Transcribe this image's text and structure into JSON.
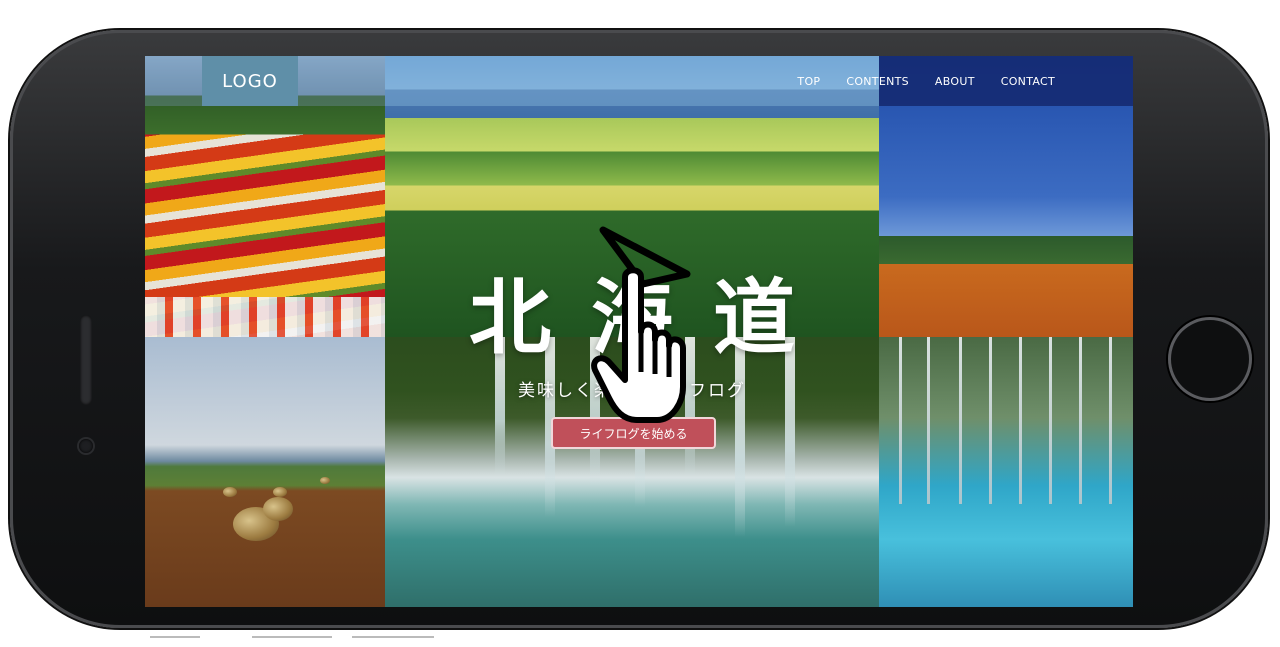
{
  "nav": {
    "logo": "LOGO",
    "links": [
      "TOP",
      "CONTENTS",
      "ABOUT",
      "CONTACT"
    ]
  },
  "hero": {
    "title": "北海道",
    "subtitle": "美味しく楽しくライフログ",
    "cta_label": "ライフログを始める"
  },
  "colors": {
    "cta": "#c0505a",
    "logo_bg": "#5f8fa8",
    "nav_right": "#14286e"
  },
  "icons": {
    "cursor": "hand-pointer-cursor-icon"
  }
}
